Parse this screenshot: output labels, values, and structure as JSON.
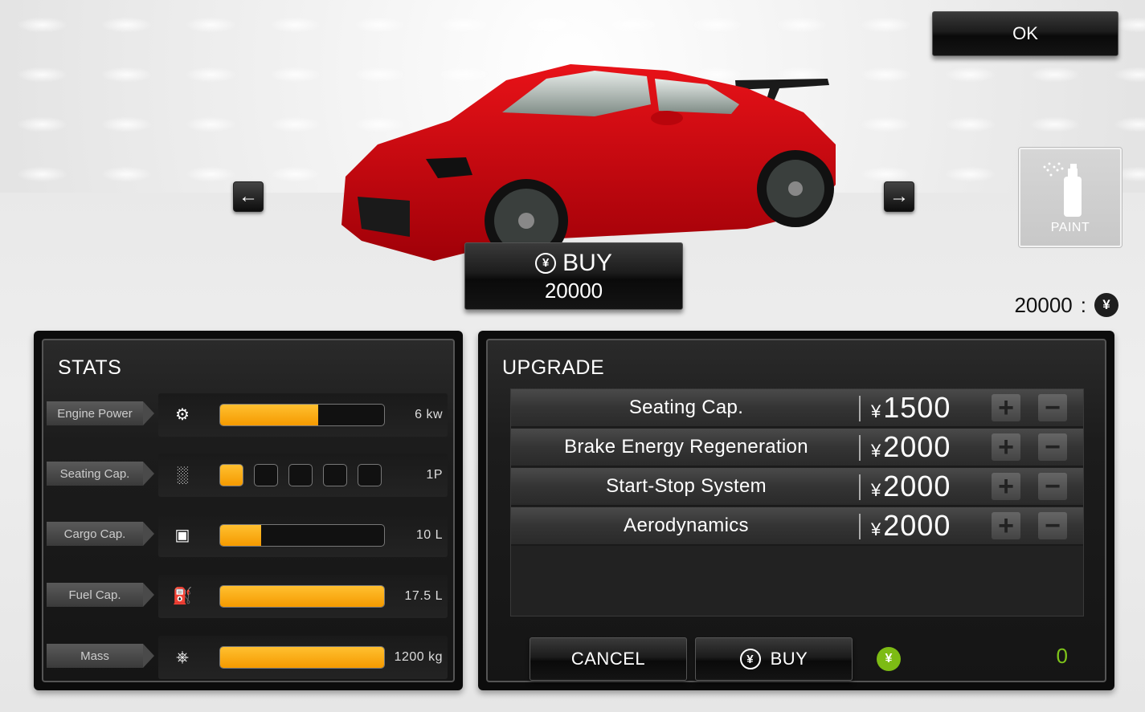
{
  "ok_label": "OK",
  "paint": {
    "label": "PAINT",
    "icon": "spray-can-icon"
  },
  "car_buy": {
    "label": "BUY",
    "price": "20000"
  },
  "balance": {
    "amount": "20000",
    "separator": ":"
  },
  "stats": {
    "title": "STATS",
    "items": [
      {
        "label": "Engine Power",
        "icon": "engine-icon",
        "value": "6 kw",
        "level": 0.6
      },
      {
        "label": "Seating Cap.",
        "icon": "seat-icon",
        "value": "1P",
        "slots_filled": 1,
        "slots_total": 5
      },
      {
        "label": "Cargo Cap.",
        "icon": "luggage-icon",
        "value": "10 L",
        "level": 0.25
      },
      {
        "label": "Fuel Cap.",
        "icon": "fuel-pump-icon",
        "value": "17.5 L",
        "level": 1.0
      },
      {
        "label": "Mass",
        "icon": "scale-car-icon",
        "value": "1200 kg",
        "level": 1.0
      }
    ]
  },
  "upgrade": {
    "title": "UPGRADE",
    "currency_symbol": "¥",
    "items": [
      {
        "name": "Seating Cap.",
        "price": "1500"
      },
      {
        "name": "Brake Energy Regeneration",
        "price": "2000"
      },
      {
        "name": "Start-Stop System",
        "price": "2000"
      },
      {
        "name": "Aerodynamics",
        "price": "2000"
      }
    ],
    "cancel_label": "CANCEL",
    "buy_label": "BUY",
    "total": "0"
  },
  "colors": {
    "accent": "#f5a300",
    "total_green": "#7ec41a",
    "car_red": "#d4050a"
  }
}
